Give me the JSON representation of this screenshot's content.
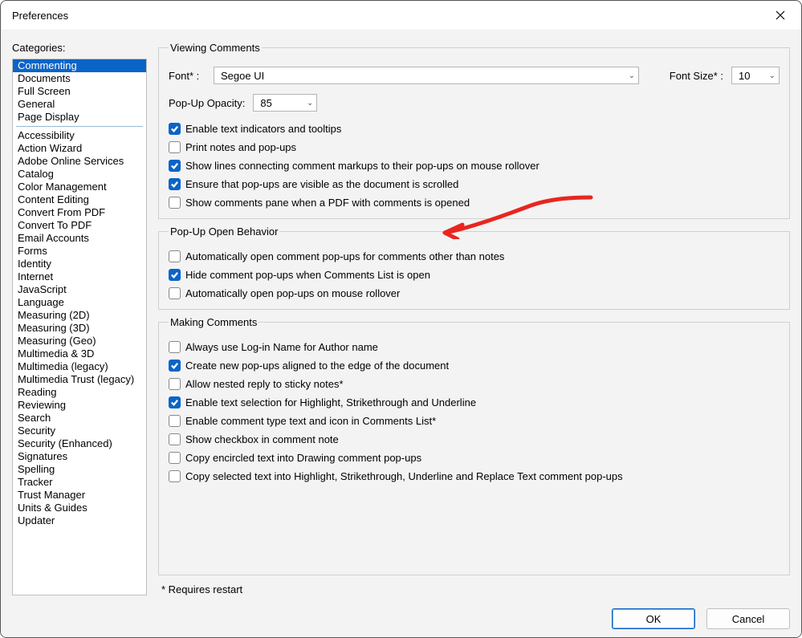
{
  "title": "Preferences",
  "categories_label": "Categories:",
  "categories_group1": [
    "Commenting",
    "Documents",
    "Full Screen",
    "General",
    "Page Display"
  ],
  "categories_group2": [
    "Accessibility",
    "Action Wizard",
    "Adobe Online Services",
    "Catalog",
    "Color Management",
    "Content Editing",
    "Convert From PDF",
    "Convert To PDF",
    "Email Accounts",
    "Forms",
    "Identity",
    "Internet",
    "JavaScript",
    "Language",
    "Measuring (2D)",
    "Measuring (3D)",
    "Measuring (Geo)",
    "Multimedia & 3D",
    "Multimedia (legacy)",
    "Multimedia Trust (legacy)",
    "Reading",
    "Reviewing",
    "Search",
    "Security",
    "Security (Enhanced)",
    "Signatures",
    "Spelling",
    "Tracker",
    "Trust Manager",
    "Units & Guides",
    "Updater"
  ],
  "selected_category_index": 0,
  "sections": {
    "viewing": {
      "legend": "Viewing Comments",
      "font_label": "Font* :",
      "font_value": "Segoe UI",
      "font_size_label": "Font Size* :",
      "font_size_value": "10",
      "popup_opacity_label": "Pop-Up Opacity:",
      "popup_opacity_value": "85",
      "opts": [
        {
          "checked": true,
          "label": "Enable text indicators and tooltips"
        },
        {
          "checked": false,
          "label": "Print notes and pop-ups"
        },
        {
          "checked": true,
          "label": "Show lines connecting comment markups to their pop-ups on mouse rollover"
        },
        {
          "checked": true,
          "label": "Ensure that pop-ups are visible as the document is scrolled"
        },
        {
          "checked": false,
          "label": "Show comments pane when a PDF with comments is opened"
        }
      ]
    },
    "popup": {
      "legend": "Pop-Up Open Behavior",
      "opts": [
        {
          "checked": false,
          "label": "Automatically open comment pop-ups for comments other than notes"
        },
        {
          "checked": true,
          "label": "Hide comment pop-ups when Comments List is open"
        },
        {
          "checked": false,
          "label": "Automatically open pop-ups on mouse rollover"
        }
      ]
    },
    "making": {
      "legend": "Making Comments",
      "opts": [
        {
          "checked": false,
          "label": "Always use Log-in Name for Author name"
        },
        {
          "checked": true,
          "label": "Create new pop-ups aligned to the edge of the document"
        },
        {
          "checked": false,
          "label": "Allow nested reply to sticky notes*"
        },
        {
          "checked": true,
          "label": "Enable text selection for Highlight, Strikethrough and Underline"
        },
        {
          "checked": false,
          "label": "Enable comment type text and icon in Comments List*"
        },
        {
          "checked": false,
          "label": "Show checkbox in comment note"
        },
        {
          "checked": false,
          "label": "Copy encircled text into Drawing comment pop-ups"
        },
        {
          "checked": false,
          "label": "Copy selected text into Highlight, Strikethrough, Underline and Replace Text comment pop-ups"
        }
      ]
    }
  },
  "footer_note": "* Requires restart",
  "buttons": {
    "ok": "OK",
    "cancel": "Cancel"
  }
}
